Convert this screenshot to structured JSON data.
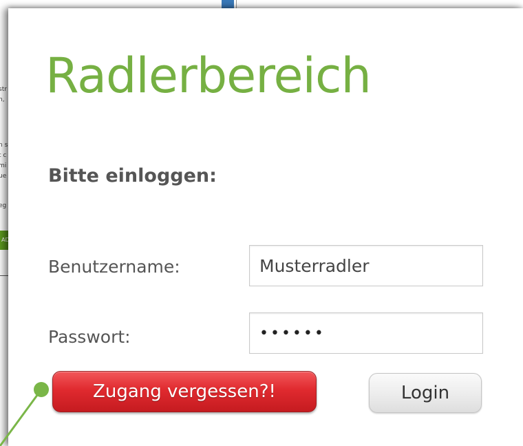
{
  "background_page": {
    "fragments": [
      "str",
      "n,",
      "n s",
      "t c",
      "mi",
      "ue",
      "eg"
    ],
    "button_fragment": "AD"
  },
  "login": {
    "title": "Radlerbereich",
    "subtitle": "Bitte einloggen:",
    "username_label": "Benutzername:",
    "username_value": "Musterradler",
    "password_label": "Passwort:",
    "password_value": "••••••",
    "forgot_button": "Zugang vergessen?!",
    "login_button": "Login"
  },
  "colors": {
    "title_green": "#76b043",
    "forgot_red": "#e02a2f",
    "annotation_green": "#7ab648",
    "text_gray": "#555555"
  }
}
